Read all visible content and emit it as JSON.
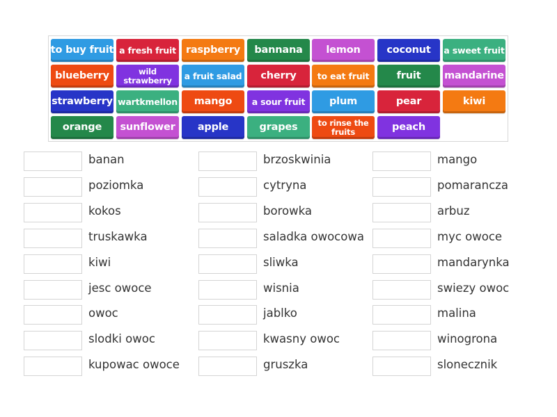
{
  "colors": {
    "blue_light": "#2f9be3",
    "red": "#d8243b",
    "orange": "#f47a12",
    "green_dark": "#24884a",
    "magenta": "#c451d2",
    "blue_dark": "#2735c7",
    "teal": "#3bb080",
    "orange_red": "#ee4a12",
    "purple": "#8033e0",
    "slot_border": "#d4d4d4",
    "label_text": "#333333"
  },
  "tiles": [
    {
      "text": "to buy fruit",
      "color": "blue_light",
      "size": "normal"
    },
    {
      "text": "a fresh fruit",
      "color": "red",
      "size": "small"
    },
    {
      "text": "raspberry",
      "color": "orange",
      "size": "normal"
    },
    {
      "text": "bannana",
      "color": "green_dark",
      "size": "normal"
    },
    {
      "text": "lemon",
      "color": "magenta",
      "size": "normal"
    },
    {
      "text": "coconut",
      "color": "blue_dark",
      "size": "normal"
    },
    {
      "text": "a sweet fruit",
      "color": "teal",
      "size": "small"
    },
    {
      "text": "blueberry",
      "color": "orange_red",
      "size": "normal"
    },
    {
      "text": "wild strawberry",
      "color": "purple",
      "size": "two"
    },
    {
      "text": "a fruit salad",
      "color": "blue_light",
      "size": "small"
    },
    {
      "text": "cherry",
      "color": "red",
      "size": "normal"
    },
    {
      "text": "to eat fruit",
      "color": "orange",
      "size": "small"
    },
    {
      "text": "fruit",
      "color": "green_dark",
      "size": "normal"
    },
    {
      "text": "mandarine",
      "color": "magenta",
      "size": "normal"
    },
    {
      "text": "strawberry",
      "color": "blue_dark",
      "size": "normal"
    },
    {
      "text": "wartkmellon",
      "color": "teal",
      "size": "small"
    },
    {
      "text": "mango",
      "color": "orange_red",
      "size": "normal"
    },
    {
      "text": "a sour fruit",
      "color": "purple",
      "size": "small"
    },
    {
      "text": "plum",
      "color": "blue_light",
      "size": "normal"
    },
    {
      "text": "pear",
      "color": "red",
      "size": "normal"
    },
    {
      "text": "kiwi",
      "color": "orange",
      "size": "normal"
    },
    {
      "text": "orange",
      "color": "green_dark",
      "size": "normal"
    },
    {
      "text": "sunflower",
      "color": "magenta",
      "size": "normal"
    },
    {
      "text": "apple",
      "color": "blue_dark",
      "size": "normal"
    },
    {
      "text": "grapes",
      "color": "teal",
      "size": "normal"
    },
    {
      "text": "to rinse the fruits",
      "color": "orange_red",
      "size": "two"
    },
    {
      "text": "peach",
      "color": "purple",
      "size": "normal"
    }
  ],
  "targets": [
    [
      "banan",
      "poziomka",
      "kokos",
      "truskawka",
      "kiwi",
      "jesc owoce",
      "owoc",
      "slodki owoc",
      "kupowac owoce"
    ],
    [
      "brzoskwinia",
      "cytryna",
      "borowka",
      "saladka owocowa",
      "sliwka",
      "wisnia",
      "jablko",
      "kwasny owoc",
      "gruszka"
    ],
    [
      "mango",
      "pomarancza",
      "arbuz",
      "myc owoce",
      "mandarynka",
      "swiezy owoc",
      "malina",
      "winogrona",
      "slonecznik"
    ]
  ]
}
